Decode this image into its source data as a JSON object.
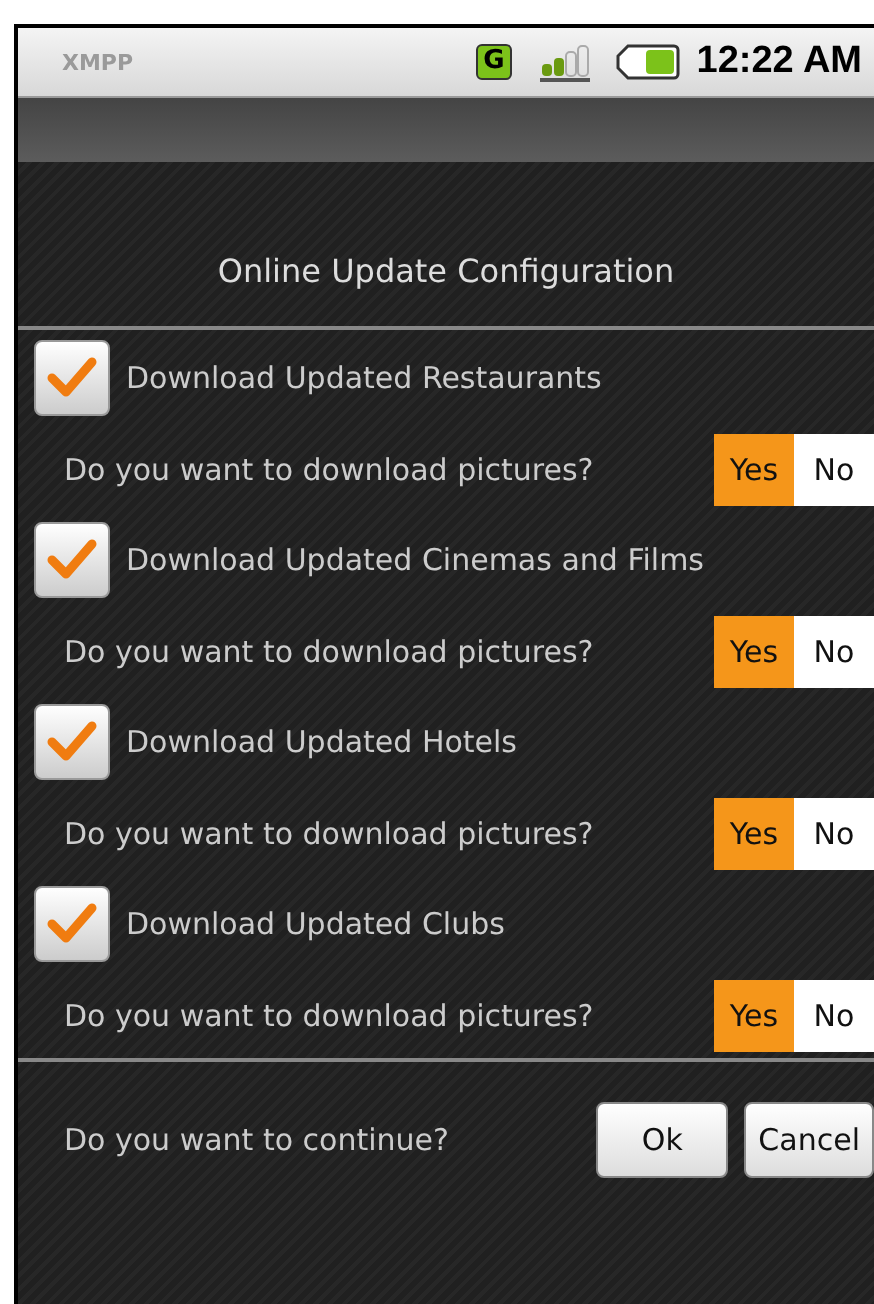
{
  "status_bar": {
    "app_label": "XMPP",
    "network_badge": "G",
    "time": "12:22 AM"
  },
  "title": "Online Update Configuration",
  "items": [
    {
      "label": "Download Updated Restaurants",
      "checked": true,
      "question": "Do you want to download pictures?",
      "options": [
        {
          "label": "Yes",
          "selected": true
        },
        {
          "label": "No",
          "selected": false
        }
      ]
    },
    {
      "label": "Download Updated Cinemas and Films",
      "checked": true,
      "question": "Do you want to download pictures?",
      "options": [
        {
          "label": "Yes",
          "selected": true
        },
        {
          "label": "No",
          "selected": false
        }
      ]
    },
    {
      "label": "Download Updated Hotels",
      "checked": true,
      "question": "Do you want to download pictures?",
      "options": [
        {
          "label": "Yes",
          "selected": true
        },
        {
          "label": "No",
          "selected": false
        }
      ]
    },
    {
      "label": "Download Updated Clubs",
      "checked": true,
      "question": "Do you want to download pictures?",
      "options": [
        {
          "label": "Yes",
          "selected": true
        },
        {
          "label": "No",
          "selected": false
        }
      ]
    }
  ],
  "footer": {
    "question": "Do you want to continue?",
    "buttons": [
      "Ok",
      "Cancel"
    ]
  }
}
